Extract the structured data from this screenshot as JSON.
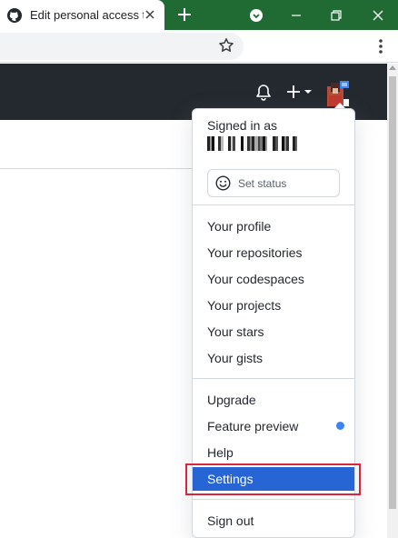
{
  "browser": {
    "tab_title": "Edit personal access to",
    "tabstrip_color": "#1f6b33"
  },
  "header": {
    "background": "#24292f"
  },
  "dropdown": {
    "signed_in_label": "Signed in as",
    "set_status_label": "Set status",
    "group1": [
      {
        "label": "Your profile"
      },
      {
        "label": "Your repositories"
      },
      {
        "label": "Your codespaces"
      },
      {
        "label": "Your projects"
      },
      {
        "label": "Your stars"
      },
      {
        "label": "Your gists"
      }
    ],
    "group2": [
      {
        "label": "Upgrade"
      },
      {
        "label": "Feature preview"
      },
      {
        "label": "Help"
      },
      {
        "label": "Settings"
      }
    ],
    "sign_out_label": "Sign out",
    "active_item": "Settings",
    "active_color": "#2764d4",
    "highlight_color": "#d7263d"
  }
}
